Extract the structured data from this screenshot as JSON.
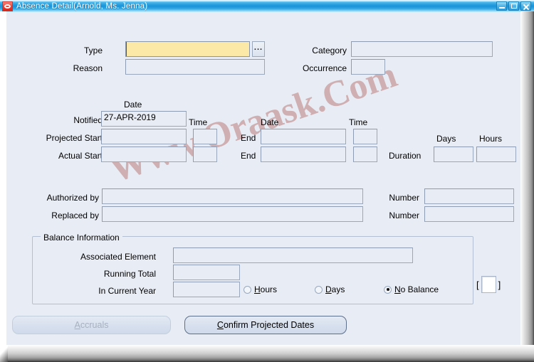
{
  "window": {
    "title": "Absence  Detail(Arnold, Ms. Jenna)",
    "icon": "oracle-logo-icon",
    "controls": {
      "minimize": "minimize-icon",
      "maximize": "maximize-icon",
      "close": "close-icon"
    }
  },
  "watermark": {
    "text": "Www.Oraask.Com",
    "color": "#c08a8a"
  },
  "colors": {
    "canvas": "#e8ecf4",
    "active_field": "#fce9a8",
    "field_border": "#9aa8bd",
    "title_bar": "#1a93d8"
  },
  "absence": {
    "type": {
      "label": "Type",
      "value": "",
      "lov_label": "...",
      "active": true
    },
    "reason": {
      "label": "Reason",
      "value": ""
    },
    "category": {
      "label": "Category",
      "value": ""
    },
    "occurrence": {
      "label": "Occurrence",
      "value": ""
    }
  },
  "dates": {
    "col_date_1": "Date",
    "col_time_1": "Time",
    "col_date_2": "Date",
    "col_time_2": "Time",
    "col_days": "Days",
    "col_hours": "Hours",
    "duration_label": "Duration",
    "rows": [
      {
        "label": "Notified",
        "date": "27-APR-2019",
        "time": "",
        "end_label": "",
        "end_date": "",
        "end_time": ""
      },
      {
        "label": "Projected Start",
        "date": "",
        "time": "",
        "end_label": "End",
        "end_date": "",
        "end_time": ""
      },
      {
        "label": "Actual Start",
        "date": "",
        "time": "",
        "end_label": "End",
        "end_date": "",
        "end_time": ""
      }
    ],
    "duration_days": "",
    "duration_hours": ""
  },
  "people": {
    "authorized_by": {
      "label": "Authorized by",
      "value": "",
      "number_label": "Number",
      "number_value": ""
    },
    "replaced_by": {
      "label": "Replaced by",
      "value": "",
      "number_label": "Number",
      "number_value": ""
    }
  },
  "balance": {
    "title": "Balance Information",
    "associated_element": {
      "label": "Associated Element",
      "value": ""
    },
    "running_total": {
      "label": "Running Total",
      "value": ""
    },
    "in_current_year": {
      "label": "In Current Year",
      "value": ""
    },
    "radios": [
      {
        "id": "hours",
        "mnemonic": "H",
        "rest": "ours",
        "selected": false
      },
      {
        "id": "days",
        "mnemonic": "D",
        "rest": "ays",
        "selected": false
      },
      {
        "id": "no-balance",
        "mnemonic": "N",
        "rest": "o Balance",
        "selected": true
      }
    ],
    "dff": {
      "open": "[",
      "close": "]",
      "value": ""
    }
  },
  "actions": {
    "accruals": {
      "mnemonic": "A",
      "rest": "ccruals",
      "enabled": false
    },
    "confirm": {
      "mnemonic": "C",
      "rest": "onfirm Projected Dates",
      "enabled": true
    }
  }
}
